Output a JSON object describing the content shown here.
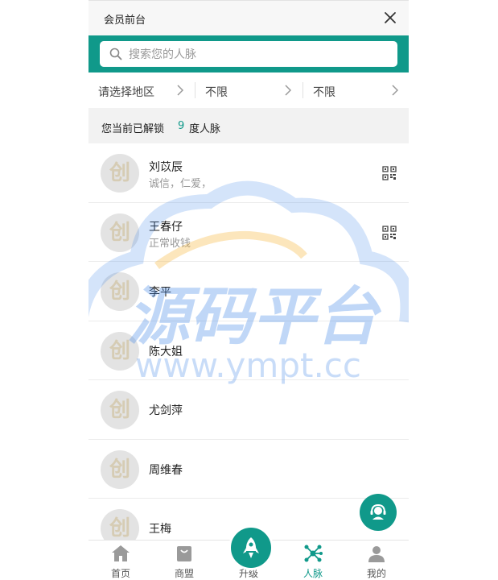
{
  "header": {
    "title": "会员前台"
  },
  "search": {
    "placeholder": "搜索您的人脉"
  },
  "filters": [
    {
      "label": "请选择地区"
    },
    {
      "label": "不限"
    },
    {
      "label": "不限"
    }
  ],
  "unlock": {
    "prefix": "您当前已解锁",
    "level": "9",
    "suffix": "度人脉"
  },
  "contacts": [
    {
      "avatar": "创",
      "name": "刘苡辰",
      "desc": "诚信，仁爱，"
    },
    {
      "avatar": "创",
      "name": "王春仔",
      "desc": "正常收钱"
    },
    {
      "avatar": "创",
      "name": "李平",
      "desc": ""
    },
    {
      "avatar": "创",
      "name": "陈大姐",
      "desc": ""
    },
    {
      "avatar": "创",
      "name": "尤剑萍",
      "desc": ""
    },
    {
      "avatar": "创",
      "name": "周维春",
      "desc": ""
    },
    {
      "avatar": "创",
      "name": "王梅",
      "desc": ""
    }
  ],
  "watermark": {
    "brand": "源码平台",
    "url": "www.ympt.cc"
  },
  "tabs": [
    {
      "label": "首页"
    },
    {
      "label": "商盟"
    },
    {
      "label": "升级"
    },
    {
      "label": "人脉"
    },
    {
      "label": "我的"
    }
  ],
  "colors": {
    "accent": "#10998a",
    "watermark": "#3b82e6",
    "watermark_accent": "#f5b640"
  }
}
